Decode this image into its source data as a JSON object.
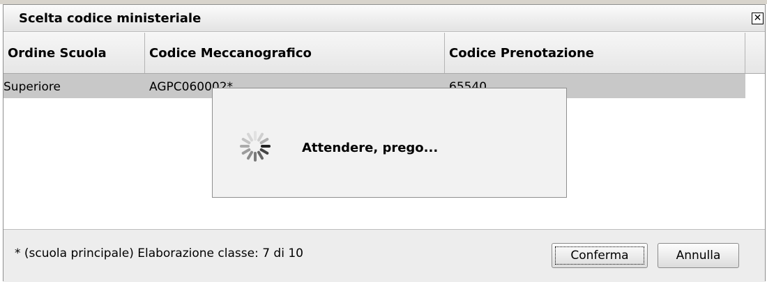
{
  "dialog": {
    "title": "Scelta codice ministeriale",
    "close_glyph": "✕"
  },
  "table": {
    "columns": [
      "Ordine Scuola",
      "Codice Meccanografico",
      "Codice Prenotazione"
    ],
    "rows": [
      {
        "ordine_scuola": "Superiore",
        "codice_meccanografico": "AGPC060002*",
        "codice_prenotazione": "65540"
      }
    ]
  },
  "footer": {
    "status_text": "* (scuola principale) Elaborazione classe: 7 di 10",
    "confirm_label": "Conferma",
    "cancel_label": "Annulla"
  },
  "loading": {
    "message": "Attendere, prego...",
    "icon": "spinner-icon"
  },
  "colors": {
    "selected_row": "#c8c8c8",
    "overlay_bg": "#f2f2f2"
  }
}
